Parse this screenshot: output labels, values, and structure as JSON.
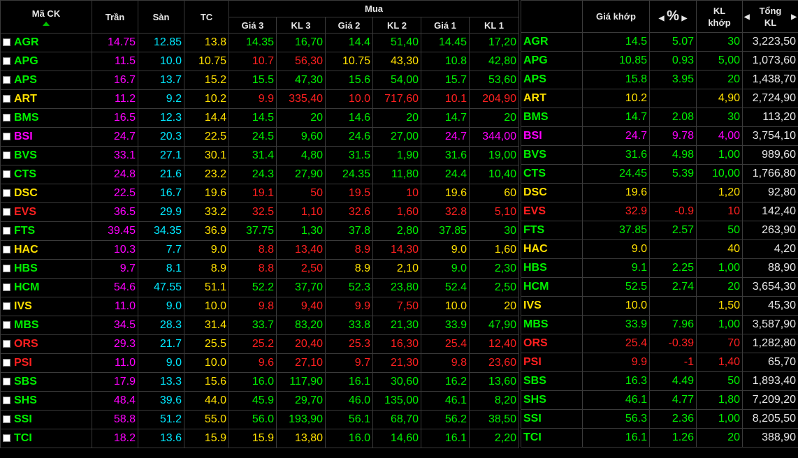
{
  "columns": {
    "symbol": "Mã CK",
    "ceiling": "Trần",
    "floor": "Sàn",
    "ref": "TC",
    "buy_group": "Mua",
    "price3": "Giá 3",
    "vol3": "KL 3",
    "price2": "Giá 2",
    "vol2": "KL 2",
    "price1": "Giá 1",
    "vol1": "KL 1",
    "match_price": "Giá khớp",
    "percent": "%",
    "match_vol": "KL khớp",
    "total_vol": "Tổng KL"
  },
  "colors": {
    "green": "#00f000",
    "red": "#ff2020",
    "yellow": "#ffe000",
    "purple": "#ff00ff",
    "cyan": "#00e8ff",
    "white": "#e8e8e8"
  },
  "icons": {
    "sort": "sort-up-triangle-icon",
    "nav_left": "chevron-left-icon",
    "nav_right": "chevron-right-icon"
  },
  "rows": [
    {
      "sym": "AGR",
      "s": "g",
      "ceil": "14.75",
      "floor": "12.85",
      "ref": "13.8",
      "p3": "14.35",
      "c3": "g",
      "v3": "16,70",
      "p2": "14.4",
      "c2": "g",
      "v2": "51,40",
      "p1": "14.45",
      "c1": "g",
      "v1": "17,20",
      "mp": "14.5",
      "mc": "g",
      "pct": "5.07",
      "mv": "30",
      "tot": "3,223,50"
    },
    {
      "sym": "APG",
      "s": "g",
      "ceil": "11.5",
      "floor": "10.0",
      "ref": "10.75",
      "p3": "10.7",
      "c3": "r",
      "v3": "56,30",
      "p2": "10.75",
      "c2": "y",
      "v2": "43,30",
      "p1": "10.8",
      "c1": "g",
      "v1": "42,80",
      "mp": "10.85",
      "mc": "g",
      "pct": "0.93",
      "mv": "5,00",
      "tot": "1,073,60"
    },
    {
      "sym": "APS",
      "s": "g",
      "ceil": "16.7",
      "floor": "13.7",
      "ref": "15.2",
      "p3": "15.5",
      "c3": "g",
      "v3": "47,30",
      "p2": "15.6",
      "c2": "g",
      "v2": "54,00",
      "p1": "15.7",
      "c1": "g",
      "v1": "53,60",
      "mp": "15.8",
      "mc": "g",
      "pct": "3.95",
      "mv": "20",
      "tot": "1,438,70"
    },
    {
      "sym": "ART",
      "s": "y",
      "ceil": "11.2",
      "floor": "9.2",
      "ref": "10.2",
      "p3": "9.9",
      "c3": "r",
      "v3": "335,40",
      "p2": "10.0",
      "c2": "r",
      "v2": "717,60",
      "p1": "10.1",
      "c1": "r",
      "v1": "204,90",
      "mp": "10.2",
      "mc": "y",
      "pct": "",
      "mv": "4,90",
      "tot": "2,724,90"
    },
    {
      "sym": "BMS",
      "s": "g",
      "ceil": "16.5",
      "floor": "12.3",
      "ref": "14.4",
      "p3": "14.5",
      "c3": "g",
      "v3": "20",
      "p2": "14.6",
      "c2": "g",
      "v2": "20",
      "p1": "14.7",
      "c1": "g",
      "v1": "20",
      "mp": "14.7",
      "mc": "g",
      "pct": "2.08",
      "mv": "30",
      "tot": "113,20"
    },
    {
      "sym": "BSI",
      "s": "p",
      "ceil": "24.7",
      "floor": "20.3",
      "ref": "22.5",
      "p3": "24.5",
      "c3": "g",
      "v3": "9,60",
      "p2": "24.6",
      "c2": "g",
      "v2": "27,00",
      "p1": "24.7",
      "c1": "p",
      "v1": "344,00",
      "mp": "24.7",
      "mc": "p",
      "pct": "9.78",
      "mv": "4,00",
      "tot": "3,754,10"
    },
    {
      "sym": "BVS",
      "s": "g",
      "ceil": "33.1",
      "floor": "27.1",
      "ref": "30.1",
      "p3": "31.4",
      "c3": "g",
      "v3": "4,80",
      "p2": "31.5",
      "c2": "g",
      "v2": "1,90",
      "p1": "31.6",
      "c1": "g",
      "v1": "19,00",
      "mp": "31.6",
      "mc": "g",
      "pct": "4.98",
      "mv": "1,00",
      "tot": "989,60"
    },
    {
      "sym": "CTS",
      "s": "g",
      "ceil": "24.8",
      "floor": "21.6",
      "ref": "23.2",
      "p3": "24.3",
      "c3": "g",
      "v3": "27,90",
      "p2": "24.35",
      "c2": "g",
      "v2": "11,80",
      "p1": "24.4",
      "c1": "g",
      "v1": "10,40",
      "mp": "24.45",
      "mc": "g",
      "pct": "5.39",
      "mv": "10,00",
      "tot": "1,766,80"
    },
    {
      "sym": "DSC",
      "s": "y",
      "ceil": "22.5",
      "floor": "16.7",
      "ref": "19.6",
      "p3": "19.1",
      "c3": "r",
      "v3": "50",
      "p2": "19.5",
      "c2": "r",
      "v2": "10",
      "p1": "19.6",
      "c1": "y",
      "v1": "60",
      "mp": "19.6",
      "mc": "y",
      "pct": "",
      "mv": "1,20",
      "tot": "92,80"
    },
    {
      "sym": "EVS",
      "s": "r",
      "ceil": "36.5",
      "floor": "29.9",
      "ref": "33.2",
      "p3": "32.5",
      "c3": "r",
      "v3": "1,10",
      "p2": "32.6",
      "c2": "r",
      "v2": "1,60",
      "p1": "32.8",
      "c1": "r",
      "v1": "5,10",
      "mp": "32.9",
      "mc": "r",
      "pct": "-0.9",
      "mv": "10",
      "tot": "142,40"
    },
    {
      "sym": "FTS",
      "s": "g",
      "ceil": "39.45",
      "floor": "34.35",
      "ref": "36.9",
      "p3": "37.75",
      "c3": "g",
      "v3": "1,30",
      "p2": "37.8",
      "c2": "g",
      "v2": "2,80",
      "p1": "37.85",
      "c1": "g",
      "v1": "30",
      "mp": "37.85",
      "mc": "g",
      "pct": "2.57",
      "mv": "50",
      "tot": "263,90"
    },
    {
      "sym": "HAC",
      "s": "y",
      "ceil": "10.3",
      "floor": "7.7",
      "ref": "9.0",
      "p3": "8.8",
      "c3": "r",
      "v3": "13,40",
      "p2": "8.9",
      "c2": "r",
      "v2": "14,30",
      "p1": "9.0",
      "c1": "y",
      "v1": "1,60",
      "mp": "9.0",
      "mc": "y",
      "pct": "",
      "mv": "40",
      "tot": "4,20"
    },
    {
      "sym": "HBS",
      "s": "g",
      "ceil": "9.7",
      "floor": "8.1",
      "ref": "8.9",
      "p3": "8.8",
      "c3": "r",
      "v3": "2,50",
      "p2": "8.9",
      "c2": "y",
      "v2": "2,10",
      "p1": "9.0",
      "c1": "g",
      "v1": "2,30",
      "mp": "9.1",
      "mc": "g",
      "pct": "2.25",
      "mv": "1,00",
      "tot": "88,90"
    },
    {
      "sym": "HCM",
      "s": "g",
      "ceil": "54.6",
      "floor": "47.55",
      "ref": "51.1",
      "p3": "52.2",
      "c3": "g",
      "v3": "37,70",
      "p2": "52.3",
      "c2": "g",
      "v2": "23,80",
      "p1": "52.4",
      "c1": "g",
      "v1": "2,50",
      "mp": "52.5",
      "mc": "g",
      "pct": "2.74",
      "mv": "20",
      "tot": "3,654,30"
    },
    {
      "sym": "IVS",
      "s": "y",
      "ceil": "11.0",
      "floor": "9.0",
      "ref": "10.0",
      "p3": "9.8",
      "c3": "r",
      "v3": "9,40",
      "p2": "9.9",
      "c2": "r",
      "v2": "7,50",
      "p1": "10.0",
      "c1": "y",
      "v1": "20",
      "mp": "10.0",
      "mc": "y",
      "pct": "",
      "mv": "1,50",
      "tot": "45,30"
    },
    {
      "sym": "MBS",
      "s": "g",
      "ceil": "34.5",
      "floor": "28.3",
      "ref": "31.4",
      "p3": "33.7",
      "c3": "g",
      "v3": "83,20",
      "p2": "33.8",
      "c2": "g",
      "v2": "21,30",
      "p1": "33.9",
      "c1": "g",
      "v1": "47,90",
      "mp": "33.9",
      "mc": "g",
      "pct": "7.96",
      "mv": "1,00",
      "tot": "3,587,90"
    },
    {
      "sym": "ORS",
      "s": "r",
      "ceil": "29.3",
      "floor": "21.7",
      "ref": "25.5",
      "p3": "25.2",
      "c3": "r",
      "v3": "20,40",
      "p2": "25.3",
      "c2": "r",
      "v2": "16,30",
      "p1": "25.4",
      "c1": "r",
      "v1": "12,40",
      "mp": "25.4",
      "mc": "r",
      "pct": "-0.39",
      "mv": "70",
      "tot": "1,282,80"
    },
    {
      "sym": "PSI",
      "s": "r",
      "ceil": "11.0",
      "floor": "9.0",
      "ref": "10.0",
      "p3": "9.6",
      "c3": "r",
      "v3": "27,10",
      "p2": "9.7",
      "c2": "r",
      "v2": "21,30",
      "p1": "9.8",
      "c1": "r",
      "v1": "23,60",
      "mp": "9.9",
      "mc": "r",
      "pct": "-1",
      "mv": "1,40",
      "tot": "65,70"
    },
    {
      "sym": "SBS",
      "s": "g",
      "ceil": "17.9",
      "floor": "13.3",
      "ref": "15.6",
      "p3": "16.0",
      "c3": "g",
      "v3": "117,90",
      "p2": "16.1",
      "c2": "g",
      "v2": "30,60",
      "p1": "16.2",
      "c1": "g",
      "v1": "13,60",
      "mp": "16.3",
      "mc": "g",
      "pct": "4.49",
      "mv": "50",
      "tot": "1,893,40"
    },
    {
      "sym": "SHS",
      "s": "g",
      "ceil": "48.4",
      "floor": "39.6",
      "ref": "44.0",
      "p3": "45.9",
      "c3": "g",
      "v3": "29,70",
      "p2": "46.0",
      "c2": "g",
      "v2": "135,00",
      "p1": "46.1",
      "c1": "g",
      "v1": "8,20",
      "mp": "46.1",
      "mc": "g",
      "pct": "4.77",
      "mv": "1,80",
      "tot": "7,209,20"
    },
    {
      "sym": "SSI",
      "s": "g",
      "ceil": "58.8",
      "floor": "51.2",
      "ref": "55.0",
      "p3": "56.0",
      "c3": "g",
      "v3": "193,90",
      "p2": "56.1",
      "c2": "g",
      "v2": "68,70",
      "p1": "56.2",
      "c1": "g",
      "v1": "38,50",
      "mp": "56.3",
      "mc": "g",
      "pct": "2.36",
      "mv": "1,00",
      "tot": "8,205,50"
    },
    {
      "sym": "TCI",
      "s": "g",
      "ceil": "18.2",
      "floor": "13.6",
      "ref": "15.9",
      "p3": "15.9",
      "c3": "y",
      "v3": "13,80",
      "p2": "16.0",
      "c2": "g",
      "v2": "14,60",
      "p1": "16.1",
      "c1": "g",
      "v1": "2,20",
      "mp": "16.1",
      "mc": "g",
      "pct": "1.26",
      "mv": "20",
      "tot": "388,90"
    }
  ]
}
